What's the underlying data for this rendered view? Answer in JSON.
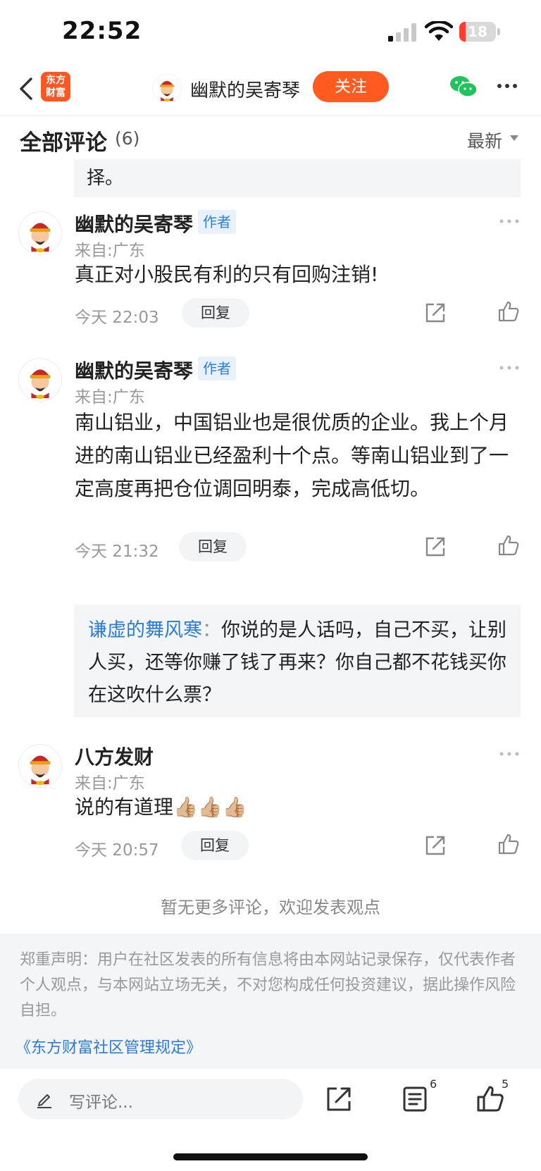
{
  "status_bar": {
    "time": "22:52",
    "battery": "18",
    "battery_level": 0.18,
    "battery_color": "#ff3b30"
  },
  "nav": {
    "logo_line1": "东方",
    "logo_line2": "财富",
    "username": "幽默的吴寄琴",
    "follow_label": "关注",
    "icons": [
      "back-icon",
      "wechat-icon",
      "more-icon"
    ]
  },
  "section": {
    "title": "全部评论",
    "count": "(6)",
    "sort_label": "最新"
  },
  "prev_tail": {
    "text": "择。"
  },
  "comments": [
    {
      "author": "幽默的吴寄琴",
      "badge": "作者",
      "location": "来自:广东",
      "text": "真正对小股民有利的只有回购注销!",
      "time": "今天 22:03",
      "reply_label": "回复"
    },
    {
      "author": "幽默的吴寄琴",
      "badge": "作者",
      "location": "来自:广东",
      "text": "南山铝业，中国铝业也是很优质的企业。我上个月进的南山铝业已经盈利十个点。等南山铝业到了一定高度再把仓位调回明泰，完成高低切。",
      "time": "今天 21:32",
      "reply_label": "回复",
      "sub_reply": {
        "user": "谦虚的舞风寒",
        "colon": "：",
        "text": "你说的是人话吗，自己不买，让别人买，还等你赚了钱了再来？你自己都不花钱买你在这吹什么票？"
      }
    },
    {
      "author": "八方发财",
      "location": "来自:广东",
      "text": "说的有道理",
      "emoji": "👍🏼👍🏼👍🏼",
      "time": "今天 20:57",
      "reply_label": "回复"
    }
  ],
  "no_more": "暂无更多评论，欢迎发表观点",
  "disclaimer": {
    "text": "郑重声明：用户在社区发表的所有信息将由本网站记录保存，仅代表作者个人观点，与本网站立场无关，不对您构成任何投资建议，据此操作风险自担。",
    "link": "《东方财富社区管理规定》"
  },
  "bottom_bar": {
    "input_placeholder": "写评论...",
    "comment_count": "6",
    "like_count": "5"
  },
  "colors": {
    "accent": "#ff5a1f",
    "link": "#2b7bd9",
    "badge_bg": "#e8f1fd"
  }
}
